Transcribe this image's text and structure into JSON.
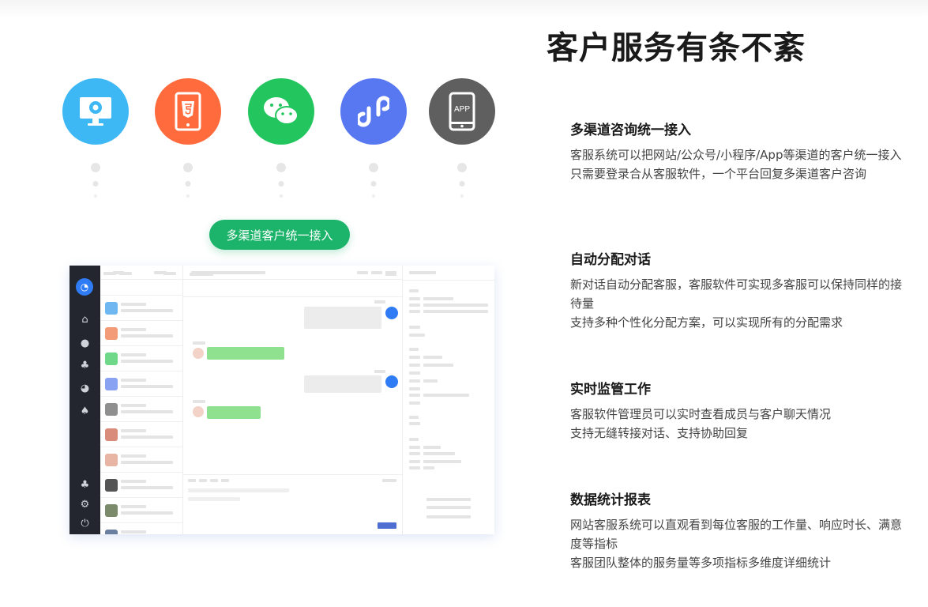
{
  "heading": "客户服务有条不紊",
  "channels": [
    {
      "name": "web-icon",
      "color": "#3db8f5"
    },
    {
      "name": "html5-icon",
      "color": "#ff6b3d"
    },
    {
      "name": "wechat-icon",
      "color": "#22c55e"
    },
    {
      "name": "mini-program-icon",
      "color": "#5878f2"
    },
    {
      "name": "app-icon",
      "color": "#5f5f5f",
      "label": "APP"
    }
  ],
  "pill_label": "多渠道客户统一接入",
  "features": [
    {
      "title": "多渠道咨询统一接入",
      "lines": [
        "客服系统可以把网站/公众号/小程序/App等渠道的客户统一接入",
        "只需要登录合从客服软件，一个平台回复多渠道客户咨询"
      ]
    },
    {
      "title": "自动分配对话",
      "lines": [
        "新对话自动分配客服，客服软件可实现多客服可以保持同样的接待量",
        "支持多种个性化分配方案，可以实现所有的分配需求"
      ]
    },
    {
      "title": "实时监管工作",
      "lines": [
        "客服软件管理员可以实时查看成员与客户聊天情况",
        "支持无缝转接对话、支持协助回复"
      ]
    },
    {
      "title": "数据统计报表",
      "lines": [
        "网站客服系统可以直观看到每位客服的工作量、响应时长、满意度等指标",
        "客服团队整体的服务量等多项指标多维度详细统计"
      ]
    }
  ]
}
